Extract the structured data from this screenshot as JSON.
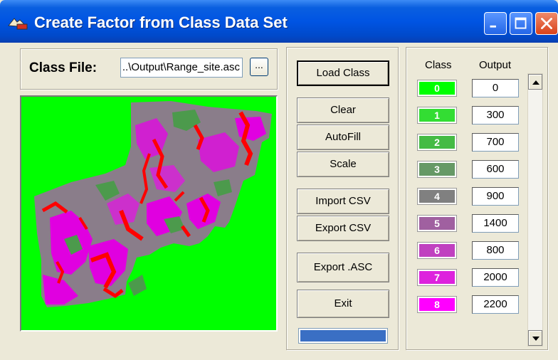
{
  "window": {
    "title": "Create Factor from Class Data Set"
  },
  "class_file": {
    "label": "Class File:",
    "value": "..\\Output\\Range_site.asc",
    "browse_label": "..."
  },
  "buttons": {
    "load_class": "Load Class",
    "clear": "Clear",
    "autofill": "AutoFill",
    "scale": "Scale",
    "import_csv": "Import CSV",
    "export_csv": "Export CSV",
    "export_asc": "Export .ASC",
    "exit": "Exit"
  },
  "progress": 1.0,
  "class_table": {
    "class_header": "Class",
    "output_header": "Output",
    "rows": [
      {
        "class": "0",
        "output": "0",
        "color": "#00ff00"
      },
      {
        "class": "1",
        "output": "300",
        "color": "#33dd33"
      },
      {
        "class": "2",
        "output": "700",
        "color": "#44bb44"
      },
      {
        "class": "3",
        "output": "600",
        "color": "#669966"
      },
      {
        "class": "4",
        "output": "900",
        "color": "#808080"
      },
      {
        "class": "5",
        "output": "1400",
        "color": "#a060a0"
      },
      {
        "class": "6",
        "output": "800",
        "color": "#c040c0"
      },
      {
        "class": "7",
        "output": "2000",
        "color": "#dd22dd"
      },
      {
        "class": "8",
        "output": "2200",
        "color": "#ff00ff"
      }
    ]
  },
  "colors": {
    "map_background": "#00ff00",
    "terrain_gray": "#8a7d8a",
    "terrain_magenta": "#e000e0",
    "terrain_red": "#ff0000",
    "terrain_green": "#4c9a4c"
  }
}
